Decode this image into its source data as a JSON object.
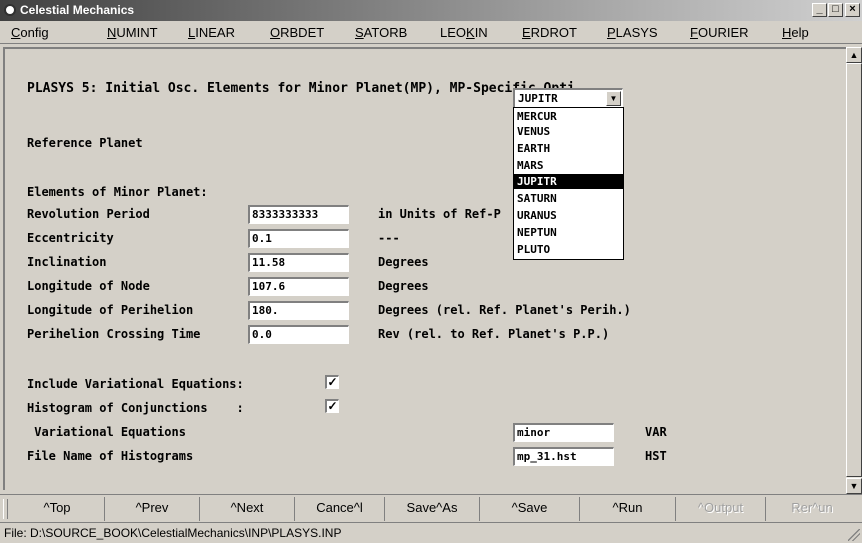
{
  "window": {
    "title": "Celestial Mechanics",
    "controls": {
      "minimize": "_",
      "maximize": "□",
      "close": "×"
    }
  },
  "menu": [
    {
      "accel": "C",
      "rest": "onfig"
    },
    {
      "accel": "N",
      "rest": "UMINT"
    },
    {
      "accel": "L",
      "rest": "INEAR"
    },
    {
      "accel": "O",
      "rest": "RBDET"
    },
    {
      "accel": "S",
      "rest": "ATORB"
    },
    {
      "accel_pre": "LEO",
      "accel": "K",
      "rest": "IN"
    },
    {
      "accel": "E",
      "rest": "RDROT"
    },
    {
      "accel": "P",
      "rest": "LASYS"
    },
    {
      "accel": "F",
      "rest": "OURIER"
    },
    {
      "accel": "H",
      "rest": "elp"
    }
  ],
  "form": {
    "heading": "PLASYS 5: Initial Osc. Elements for Minor Planet(MP), MP-Specific Opti",
    "reference_planet": {
      "label": "Reference Planet",
      "value": "JUPITR",
      "options": [
        "MERCUR",
        "VENUS",
        "EARTH",
        "MARS",
        "JUPITR",
        "SATURN",
        "URANUS",
        "NEPTUN",
        "PLUTO"
      ],
      "selected_index": 4
    },
    "elements_heading": "Elements of Minor Planet:",
    "rows": [
      {
        "label": "Revolution Period",
        "value": "8333333333",
        "unit": "in Units of Ref-P          lutions"
      },
      {
        "label": "Eccentricity",
        "value": "0.1",
        "unit": "---"
      },
      {
        "label": "Inclination",
        "value": "11.58",
        "unit": "Degrees"
      },
      {
        "label": "Longitude of Node",
        "value": "107.6",
        "unit": "Degrees"
      },
      {
        "label": "Longitude of Perihelion",
        "value": "180.",
        "unit": "Degrees (rel. Ref. Planet's Perih.)"
      },
      {
        "label": "Perihelion Crossing Time",
        "value": "0.0",
        "unit": "Rev (rel. to Ref. Planet's P.P.)"
      }
    ],
    "checks": [
      {
        "label": "Include Variational Equations:",
        "checked": true,
        "mark": "✓"
      },
      {
        "label": "Histogram of Conjunctions    :",
        "checked": true,
        "mark": "✓"
      }
    ],
    "files": [
      {
        "label": " Variational Equations",
        "value": "minor",
        "ext": "VAR"
      },
      {
        "label": "File Name of Histograms",
        "value": "mp_31.hst",
        "ext": "HST"
      }
    ]
  },
  "scrollbar": {
    "up": "▲",
    "down": "▼"
  },
  "toolbar": [
    {
      "label": "^Top",
      "enabled": true
    },
    {
      "label": "^Prev",
      "enabled": true
    },
    {
      "label": "^Next",
      "enabled": true
    },
    {
      "label": "Cance^l",
      "enabled": true
    },
    {
      "label": "Save^As",
      "enabled": true
    },
    {
      "label": "^Save",
      "enabled": true
    },
    {
      "label": "^Run",
      "enabled": true
    },
    {
      "label": "^Output",
      "enabled": false
    },
    {
      "label": "Rer^un",
      "enabled": false
    }
  ],
  "status": "File: D:\\SOURCE_BOOK\\CelestialMechanics\\INP\\PLASYS.INP",
  "combo_arrow": "▼"
}
